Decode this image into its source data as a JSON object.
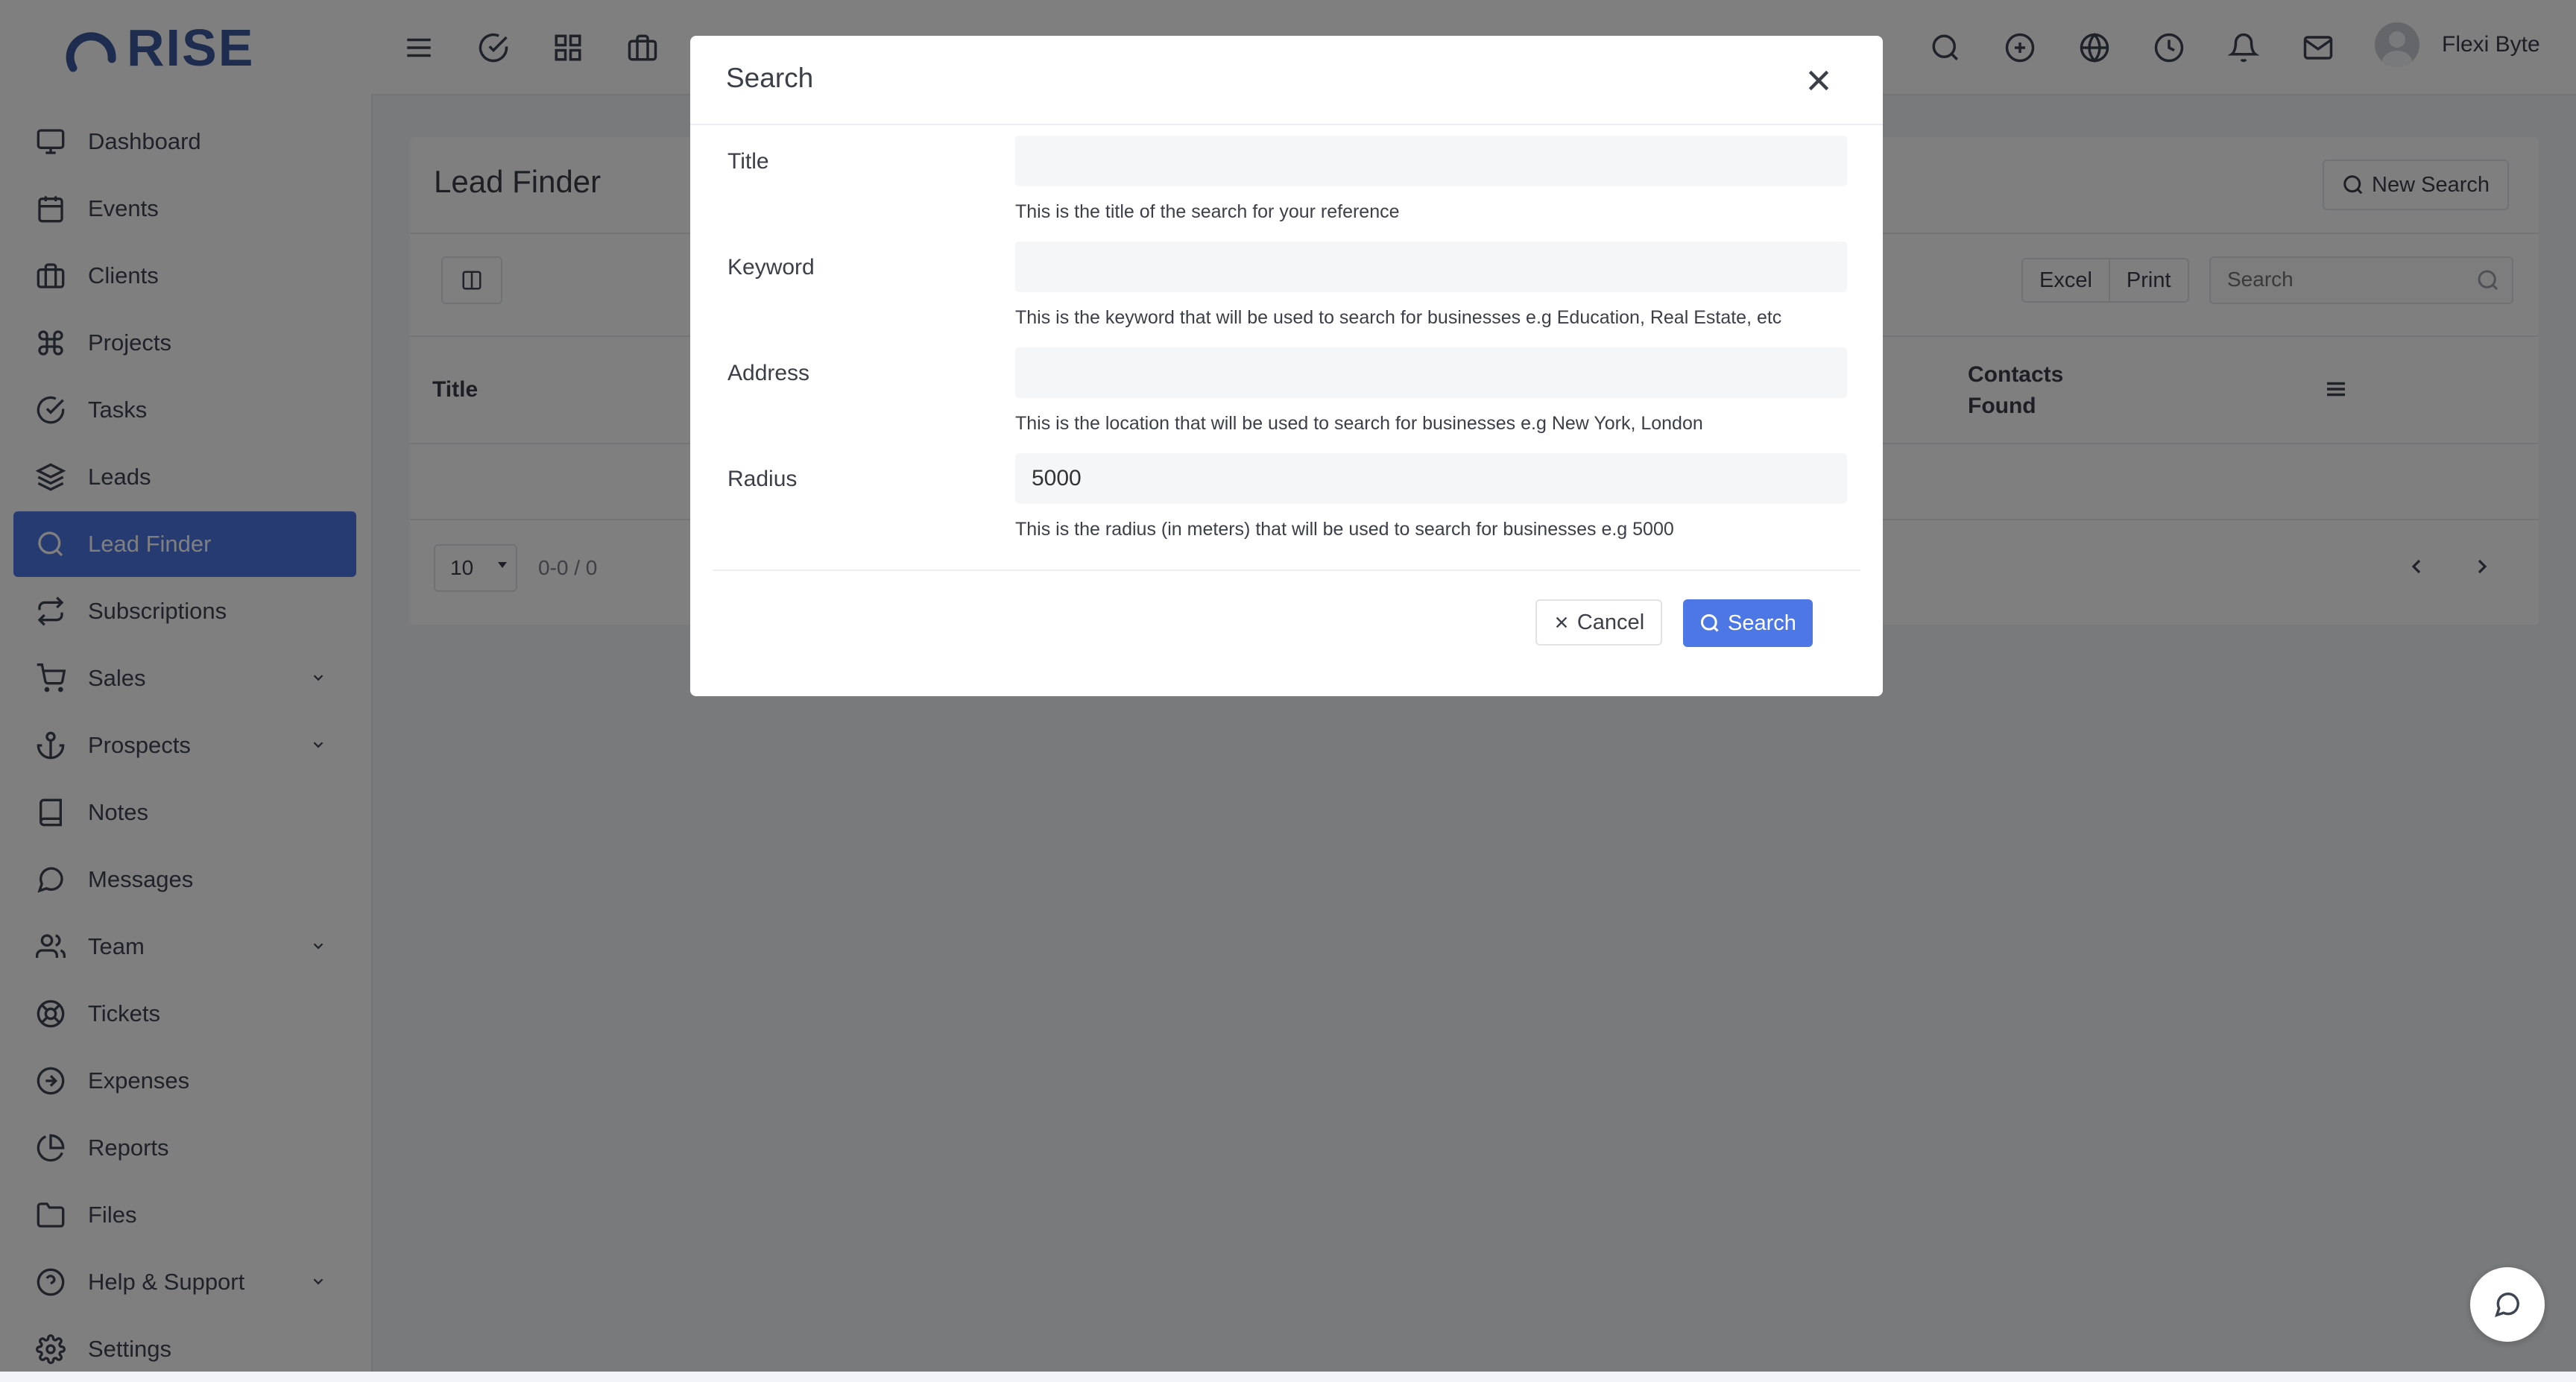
{
  "app": {
    "brand": "RISE",
    "user_name": "Flexi Byte"
  },
  "topbar": {
    "left_icons": [
      "menu-icon",
      "check-circle-icon",
      "grid-icon",
      "briefcase-icon"
    ],
    "right_icons": [
      "search-icon",
      "plus-circle-icon",
      "globe-icon",
      "clock-icon",
      "bell-icon",
      "mail-icon"
    ]
  },
  "sidebar": {
    "items": [
      {
        "label": "Dashboard",
        "icon": "monitor-icon"
      },
      {
        "label": "Events",
        "icon": "calendar-icon"
      },
      {
        "label": "Clients",
        "icon": "briefcase-icon"
      },
      {
        "label": "Projects",
        "icon": "command-icon"
      },
      {
        "label": "Tasks",
        "icon": "check-circle-icon"
      },
      {
        "label": "Leads",
        "icon": "layers-icon"
      },
      {
        "label": "Lead Finder",
        "icon": "search-icon",
        "active": true
      },
      {
        "label": "Subscriptions",
        "icon": "repeat-icon"
      },
      {
        "label": "Sales",
        "icon": "shopping-cart-icon",
        "has_children": true
      },
      {
        "label": "Prospects",
        "icon": "anchor-icon",
        "has_children": true
      },
      {
        "label": "Notes",
        "icon": "book-icon"
      },
      {
        "label": "Messages",
        "icon": "message-circle-icon"
      },
      {
        "label": "Team",
        "icon": "users-icon",
        "has_children": true
      },
      {
        "label": "Tickets",
        "icon": "life-buoy-icon"
      },
      {
        "label": "Expenses",
        "icon": "arrow-right-circle-icon"
      },
      {
        "label": "Reports",
        "icon": "pie-chart-icon"
      },
      {
        "label": "Files",
        "icon": "folder-icon"
      },
      {
        "label": "Help & Support",
        "icon": "help-circle-icon",
        "has_children": true
      },
      {
        "label": "Settings",
        "icon": "settings-icon"
      }
    ]
  },
  "page": {
    "title": "Lead Finder",
    "new_search_label": "New Search",
    "export_excel": "Excel",
    "export_print": "Print",
    "search_placeholder": "Search",
    "table": {
      "columns": [
        "Title",
        "Contacts Found"
      ]
    },
    "pagination": {
      "page_size": "10",
      "info": "0-0 / 0"
    }
  },
  "modal": {
    "title": "Search",
    "fields": [
      {
        "label": "Title",
        "value": "",
        "help": "This is the title of the search for your reference"
      },
      {
        "label": "Keyword",
        "value": "",
        "help": "This is the keyword that will be used to search for businesses e.g Education, Real Estate, etc"
      },
      {
        "label": "Address",
        "value": "",
        "help": "This is the location that will be used to search for businesses e.g New York, London"
      },
      {
        "label": "Radius",
        "value": "5000",
        "help": "This is the radius (in meters) that will be used to search for businesses e.g 5000"
      }
    ],
    "cancel_label": "Cancel",
    "search_label": "Search"
  },
  "colors": {
    "accent": "#4e77e6",
    "brand": "#3d5a9e",
    "overlay": "rgba(0,0,0,0.5)"
  }
}
